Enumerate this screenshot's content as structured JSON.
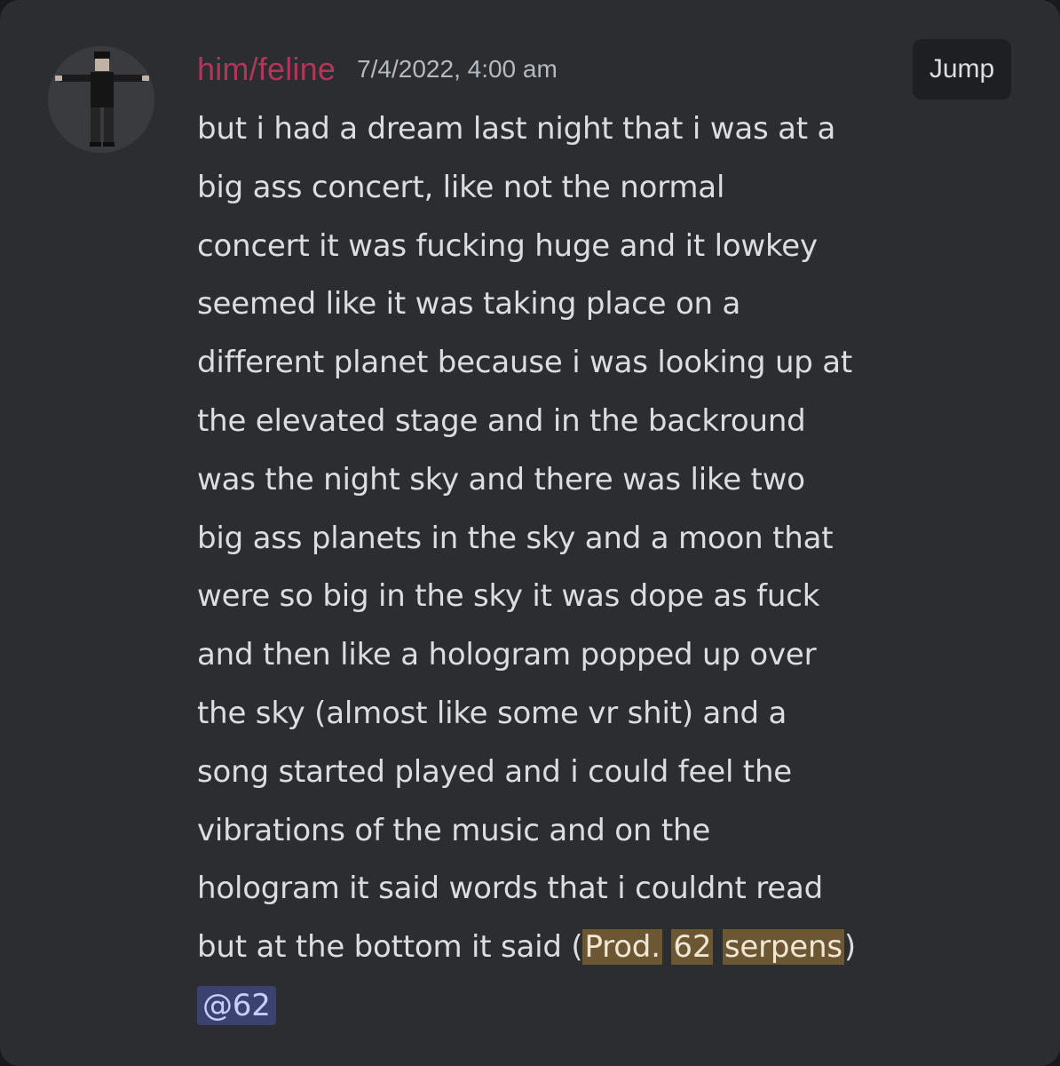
{
  "message": {
    "author": "him/feline",
    "timestamp": "7/4/2022, 4:00 am",
    "jump_label": "Jump",
    "lines": [
      "but i had a dream last night that i was at a",
      "big ass concert, like not the normal",
      "concert it was fucking huge and it lowkey",
      "seemed like it was taking place on a",
      "different planet because i was looking up at",
      "the elevated stage and in the backround",
      "was the night sky and there was like two",
      "big ass planets in the sky and a moon that",
      "were so big in the sky it was dope as fuck",
      "and then like a hologram popped up over",
      "the sky (almost like some vr shit) and a",
      "song started played and i could feel the",
      "vibrations of the music and on the",
      "hologram it said words that i couldnt read"
    ],
    "last_line": {
      "prefix": "but at the bottom it said (",
      "highlight_1": "Prod.",
      "sep_1": " ",
      "highlight_2": "62",
      "sep_2": " ",
      "highlight_3": "serpens",
      "suffix": ")"
    },
    "mention": "@62"
  },
  "colors": {
    "background": "#2b2d31",
    "username": "#b0365a",
    "timestamp": "#b5bac1",
    "text": "#dbdee1",
    "highlight": "#6b5733",
    "mention_bg": "#3c4270",
    "jump_bg": "#1e1f22"
  },
  "icons": {
    "avatar": "t-pose-character-avatar"
  }
}
